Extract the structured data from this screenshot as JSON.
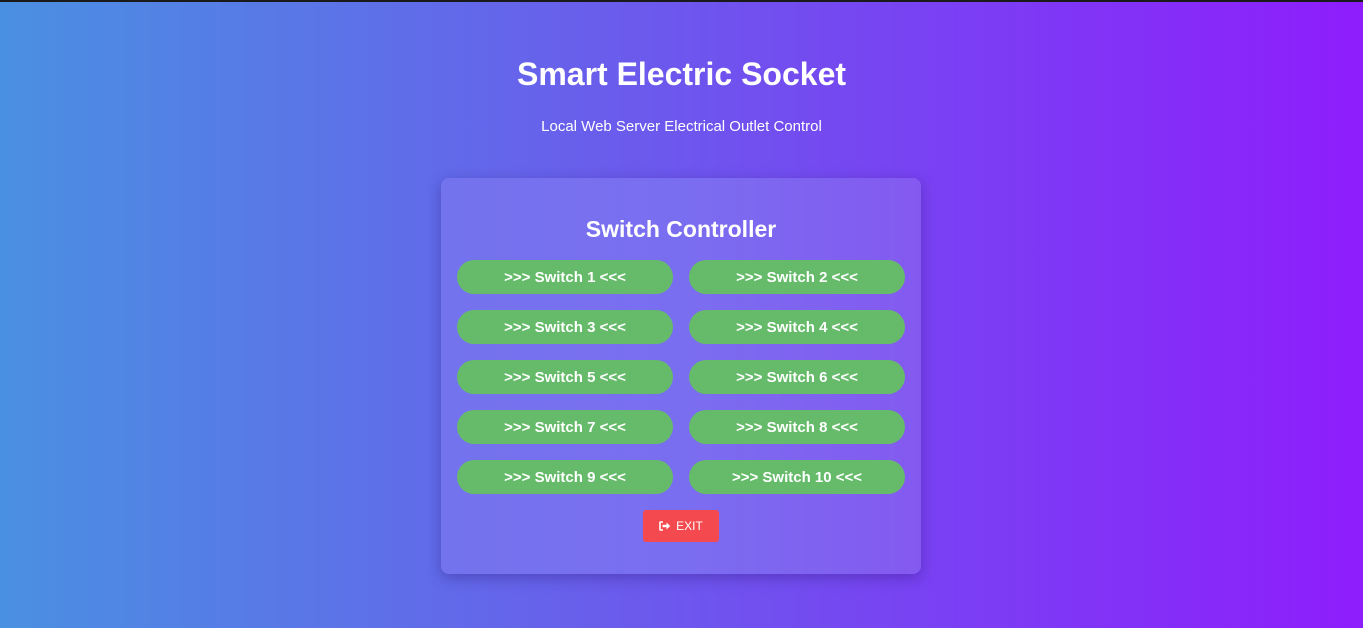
{
  "header": {
    "title": "Smart Electric Socket",
    "subtitle": "Local Web Server Electrical Outlet Control"
  },
  "panel": {
    "title": "Switch Controller",
    "switches": [
      {
        "label": ">>> Switch 1 <<<"
      },
      {
        "label": ">>> Switch 2 <<<"
      },
      {
        "label": ">>> Switch 3 <<<"
      },
      {
        "label": ">>> Switch 4 <<<"
      },
      {
        "label": ">>> Switch 5 <<<"
      },
      {
        "label": ">>> Switch 6 <<<"
      },
      {
        "label": ">>> Switch 7 <<<"
      },
      {
        "label": ">>> Switch 8 <<<"
      },
      {
        "label": ">>> Switch 9 <<<"
      },
      {
        "label": ">>> Switch 10 <<<"
      }
    ],
    "exit": {
      "label": "EXIT",
      "icon": "sign-out-icon"
    }
  },
  "colors": {
    "switch_button": "#66bb6a",
    "exit_button": "#f44a4f",
    "background_start": "#4a90e2",
    "background_end": "#8e1dfc"
  }
}
